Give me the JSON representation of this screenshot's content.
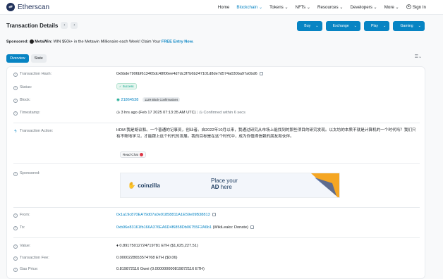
{
  "brand": {
    "name": "Etherscan"
  },
  "nav": {
    "items": [
      "Home",
      "Blockchain",
      "Tokens",
      "NFTs",
      "Resources",
      "Developers",
      "More"
    ],
    "signin": "Sign In"
  },
  "page": {
    "title": "Transaction Details"
  },
  "actions": [
    "Buy",
    "Exchange",
    "Play",
    "Gaming"
  ],
  "sponsor": {
    "label": "Sponsored:",
    "name": "MetaWin:",
    "text": "WIN $50k+ in the Metawin Millionaire each Week! Claim Your",
    "cta": "FREE Entry Now."
  },
  "tabs": [
    "Overview",
    "State"
  ],
  "details": {
    "tx_hash_label": "Transaction Hash:",
    "tx_hash": "0x6bde7906bf613465dc48f06ee4d7dc3f7b6b247101d8de7d574a030ba97a0bd6",
    "status_label": "Status:",
    "status": "Success",
    "block_label": "Block:",
    "block": "21864538",
    "confirmations": "1129 Block Confirmations",
    "timestamp_label": "Timestamp:",
    "timestamp": "3 hrs ago (Feb 17 2025 07:13:35 AM UTC)",
    "confirmed": "Confirmed within 6 secs",
    "action_label": "Transaction Action:",
    "action_text": "HDM 我是胡议和。一个普通的记事员，创业者。自2022年10月以来，我通过研究从市场上能找到的那些项目的研究发现。以太坊的本质不就是计算机的一个时代吗？我们只有不断地学习，才能跟上这个时代的发展。我的目标是在这个时代中，成为你值得信赖的朋友和伙伴。",
    "readchat": "Read Chat",
    "sponsored_label": "Sponsored:",
    "ad_brand": "coinzilla",
    "ad_line1": "Place your",
    "ad_line2_bold": "AD",
    "ad_line2": "here",
    "from_label": "From:",
    "from": "0x1a19c870EA79d07a0e91858811A1E59e09B38813",
    "to_label": "To:",
    "to": "0xb96e83161fb166A376EA6D4f6858Db06755F2A6b1",
    "to_tag": "(WikiLeaks: Donate)",
    "value_label": "Value:",
    "value": "0.89175012724719781 ETH ($1,625,227.51)",
    "fee_label": "Transaction Fee:",
    "fee": "0.0000228653574768 ETH ($0.06)",
    "gas_label": "Gas Price:",
    "gas": "0.819872116 Gwei (0.000000000819872116 ETH)"
  }
}
